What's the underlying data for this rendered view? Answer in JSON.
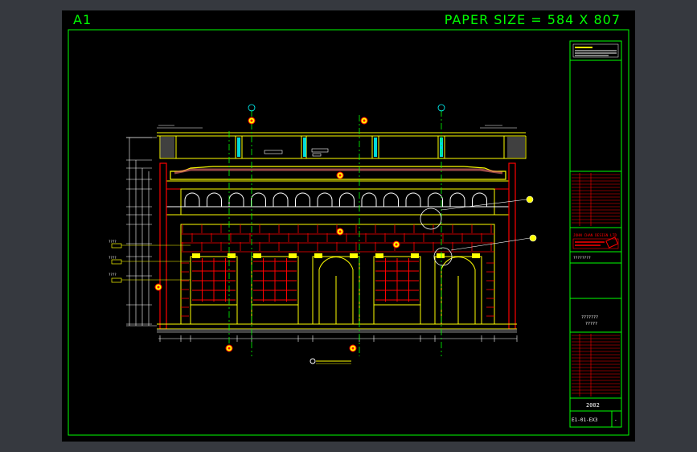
{
  "sheet": {
    "label": "A1",
    "paper_size": "PAPER SIZE = 584 X 807"
  },
  "title_block": {
    "company": "JOHN CHAN DESIGN LTD",
    "project_placeholder": "????????",
    "drawing_title": "???????",
    "drawing_title_2": "?????",
    "year": "2002",
    "drawing_no": "E1-01-EX3"
  },
  "annotations": {
    "q4": "????",
    "q4b": "????",
    "q4c": "????"
  },
  "colors": {
    "frame": "#00ff00",
    "structure": "#ffff00",
    "brick": "#ff0000",
    "cyan": "#00ffff",
    "white": "#ffffff"
  }
}
